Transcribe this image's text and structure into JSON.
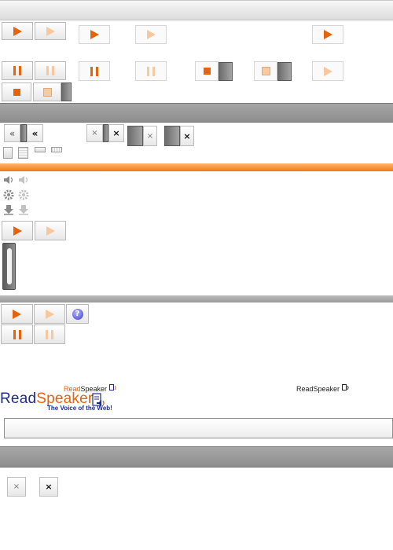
{
  "brand": {
    "prefix": "Read",
    "suffix": "Speaker",
    "tagline": "The Voice of the Web!",
    "colors": {
      "orange": "#e8620c",
      "blue": "#1d2b8c"
    }
  },
  "icons": {
    "play": "play-icon",
    "pause": "pause-icon",
    "stop": "stop-icon",
    "rewind": "double-chevron-left-icon",
    "close": "close-icon",
    "help": "help-icon",
    "volume": "speaker-icon",
    "settings": "gear-icon",
    "download": "download-icon"
  },
  "controls": {
    "rewind_glyph": "«",
    "close_glyph": "×",
    "help_glyph": "?"
  }
}
